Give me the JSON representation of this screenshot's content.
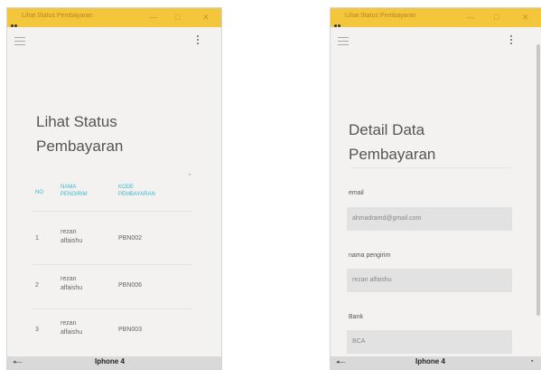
{
  "left": {
    "window_title": "Lihat Status Pembayaran",
    "heading_line1": "Lihat Status",
    "heading_line2": "Pembayaran",
    "table": {
      "headers": {
        "no": "NO",
        "nama_line1": "NAMA",
        "nama_line2": "PENGIRIM",
        "kode_line1": "KODE",
        "kode_line2": "PEMBAYARAN"
      },
      "rows": [
        {
          "no": "1",
          "name_line1": "rezan",
          "name_line2": "alfaishu",
          "kode": "PBN002"
        },
        {
          "no": "2",
          "name_line1": "rezan",
          "name_line2": "alfaishu",
          "kode": "PBN006"
        },
        {
          "no": "3",
          "name_line1": "rezan",
          "name_line2": "alfaishu",
          "kode": "PBN003"
        }
      ]
    },
    "device_label": "Iphone 4",
    "nav_back": "◂—"
  },
  "right": {
    "window_title": "Lihat Status Pembayaran",
    "heading_line1": "Detail Data",
    "heading_line2": "Pembayaran",
    "fields": [
      {
        "label": "email",
        "value": "ahmadramd@gmail.com"
      },
      {
        "label": "nama pengirim",
        "value": "rezan alfaishu"
      },
      {
        "label": "Bank",
        "value": "BCA"
      }
    ],
    "device_label": "Iphone 4",
    "nav_back": "◂—",
    "nav_dot": "▪"
  },
  "window_controls": {
    "minimize": "—",
    "maximize": "□",
    "close": "✕"
  },
  "colors": {
    "titlebar": "#f4c63c",
    "accent": "#3bb8c9",
    "field_bg": "#e2e2e2",
    "app_bg": "#f3f2f1"
  },
  "icons": {
    "menu": "hamburger-menu-icon",
    "more": "more-vertical-icon",
    "logo": "app-logo-icon"
  }
}
